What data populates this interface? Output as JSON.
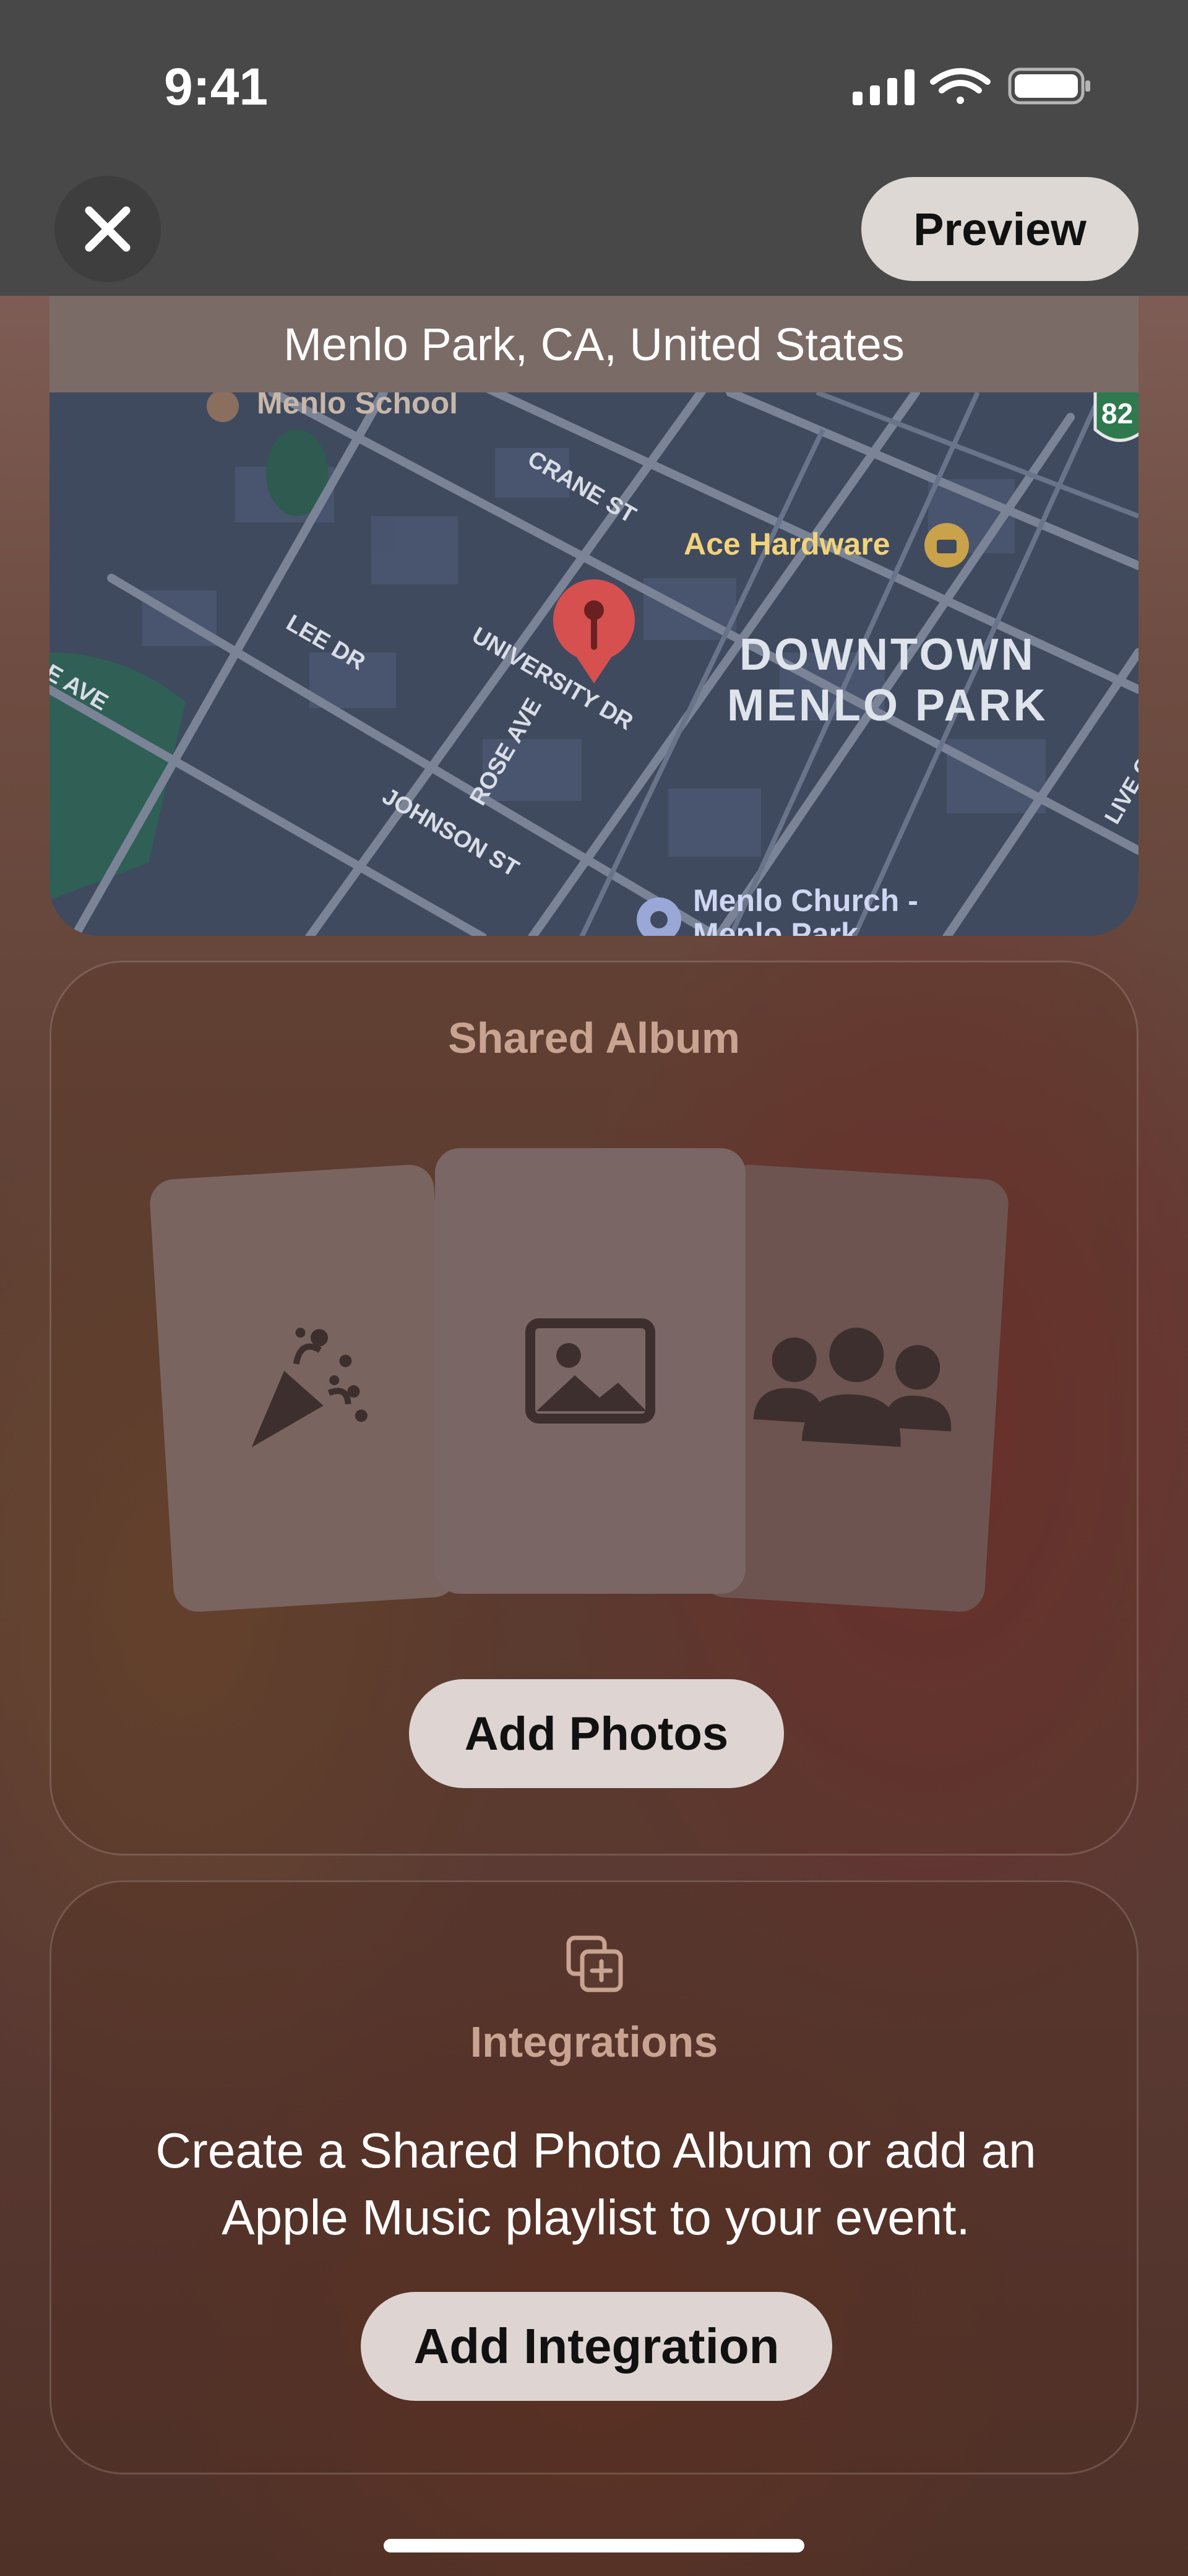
{
  "status_bar": {
    "time": "9:41",
    "icons": [
      "cellular-signal-icon",
      "wifi-icon",
      "battery-icon"
    ]
  },
  "nav": {
    "close_icon": "close-icon",
    "preview_label": "Preview"
  },
  "map": {
    "location": "Menlo Park, CA, United States",
    "labels": {
      "school": "Menlo School",
      "crane": "CRANE ST",
      "hardware": "Ace Hardware",
      "downtown1": "DOWNTOWN",
      "downtown2": "MENLO PARK",
      "lee": "LEE DR",
      "university": "UNIVERSITY DR",
      "rose": "ROSE AVE",
      "johnson": "JOHNSON ST",
      "ave": "E AVE",
      "church1": "Menlo Church -",
      "church2": "Menlo Park",
      "live": "LIVE O",
      "route": "82"
    }
  },
  "shared_album": {
    "title": "Shared Album",
    "cards": [
      "party-popper-icon",
      "photo-icon",
      "people-icon"
    ],
    "button": "Add Photos"
  },
  "integrations": {
    "icon": "add-integration-icon",
    "title": "Integrations",
    "description": "Create a Shared Photo Album or add an Apple Music playlist to your event.",
    "button": "Add Integration"
  },
  "colors": {
    "accent_label": "#c9a392",
    "button_bg": "#ded5d2",
    "map_bg": "#3f4a5e"
  }
}
